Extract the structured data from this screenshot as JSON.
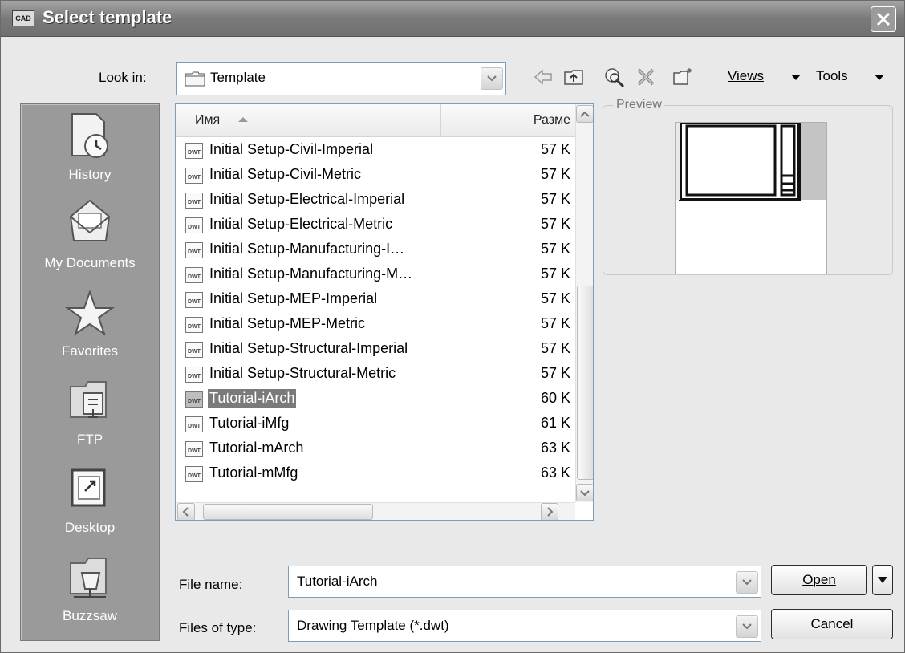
{
  "window": {
    "title": "Select template"
  },
  "lookin": {
    "label": "Look in:",
    "value": "Template"
  },
  "toolbar": {
    "views_label": "Views",
    "tools_label": "Tools",
    "icons": [
      "back-icon",
      "up-folder-icon",
      "search-web-icon",
      "delete-icon",
      "new-folder-icon"
    ]
  },
  "places": [
    {
      "label": "History",
      "icon": "history-icon"
    },
    {
      "label": "My Documents",
      "icon": "my-documents-icon"
    },
    {
      "label": "Favorites",
      "icon": "favorites-icon"
    },
    {
      "label": "FTP",
      "icon": "ftp-icon"
    },
    {
      "label": "Desktop",
      "icon": "desktop-icon"
    },
    {
      "label": "Buzzsaw",
      "icon": "buzzsaw-icon"
    }
  ],
  "filelist": {
    "columns": {
      "name": "Имя",
      "size": "Разме"
    },
    "files": [
      {
        "name": "Initial Setup-Civil-Imperial",
        "size": "57 K"
      },
      {
        "name": "Initial Setup-Civil-Metric",
        "size": "57 K"
      },
      {
        "name": "Initial Setup-Electrical-Imperial",
        "size": "57 K"
      },
      {
        "name": "Initial Setup-Electrical-Metric",
        "size": "57 K"
      },
      {
        "name": "Initial Setup-Manufacturing-I…",
        "size": "57 K"
      },
      {
        "name": "Initial Setup-Manufacturing-M…",
        "size": "57 K"
      },
      {
        "name": "Initial Setup-MEP-Imperial",
        "size": "57 K"
      },
      {
        "name": "Initial Setup-MEP-Metric",
        "size": "57 K"
      },
      {
        "name": "Initial Setup-Structural-Imperial",
        "size": "57 K"
      },
      {
        "name": "Initial Setup-Structural-Metric",
        "size": "57 K"
      },
      {
        "name": "Tutorial-iArch",
        "size": "60 K",
        "selected": true
      },
      {
        "name": "Tutorial-iMfg",
        "size": "61 K"
      },
      {
        "name": "Tutorial-mArch",
        "size": "63 K"
      },
      {
        "name": "Tutorial-mMfg",
        "size": "63 K"
      }
    ],
    "file_icon_text": "DWT"
  },
  "preview": {
    "label": "Preview"
  },
  "filename": {
    "label": "File name:",
    "value": "Tutorial-iArch"
  },
  "filetype": {
    "label": "Files of type:",
    "value": "Drawing Template (*.dwt)"
  },
  "buttons": {
    "open": "Open",
    "cancel": "Cancel"
  }
}
